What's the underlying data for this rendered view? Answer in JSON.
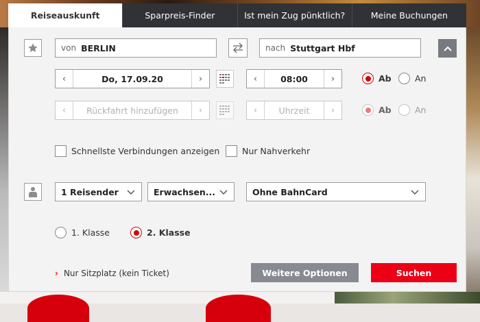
{
  "tabs": [
    {
      "label": "Reiseauskunft",
      "active": true
    },
    {
      "label": "Sparpreis-Finder",
      "active": false
    },
    {
      "label": "Ist mein Zug pünktlich?",
      "active": false
    },
    {
      "label": "Meine Buchungen",
      "active": false
    }
  ],
  "route": {
    "from_prefix": "von",
    "from_value": "BERLIN",
    "to_prefix": "nach",
    "to_value": "Stuttgart Hbf"
  },
  "outbound": {
    "date": "Do, 17.09.20",
    "time": "08:00",
    "ab_label": "Ab",
    "an_label": "An",
    "selected": "Ab"
  },
  "return": {
    "date_placeholder": "Rückfahrt hinzufügen",
    "time_placeholder": "Uhrzeit",
    "ab_label": "Ab",
    "an_label": "An",
    "selected": "Ab"
  },
  "options": {
    "fastest_label": "Schnellste Verbindungen anzeigen",
    "regional_label": "Nur Nahverkehr"
  },
  "passengers": {
    "count": "1 Reisender",
    "type": "Erwachsen...",
    "bahncard": "Ohne BahnCard"
  },
  "class": {
    "first": "1. Klasse",
    "second": "2. Klasse",
    "selected": "2. Klasse"
  },
  "footer": {
    "seat_only_link": "Nur Sitzplatz (kein Ticket)",
    "more_options": "Weitere Optionen",
    "search": "Suchen"
  },
  "colors": {
    "accent": "#ec0016",
    "tab_dark": "#303236",
    "secondary_button": "#878a91"
  }
}
